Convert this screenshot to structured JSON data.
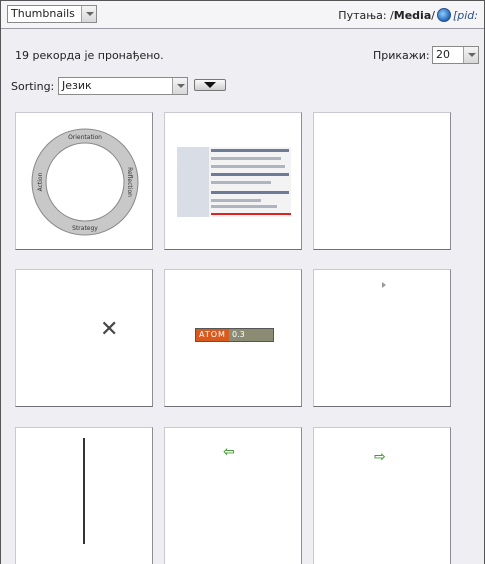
{
  "topbar": {
    "view_select": "Thumbnails",
    "path_label": "Путања: /",
    "path_current": "Media",
    "path_sep": "/",
    "pid_label": "[pid:"
  },
  "results": {
    "count_text": "19 рекорда је пронађено.",
    "show_label": "Прикажи:",
    "show_value": "20"
  },
  "sorting": {
    "label": "Sorting:",
    "value": "Језик"
  },
  "thumbnails": [
    {
      "name": "cycle-diagram",
      "labels": [
        "Orientation",
        "Reflection",
        "Strategy",
        "Action"
      ]
    },
    {
      "name": "screenshot"
    },
    {
      "name": "blank"
    },
    {
      "name": "delete-icon"
    },
    {
      "name": "atom-badge",
      "left": "ATOM",
      "right": "0.3"
    },
    {
      "name": "small-arrow"
    },
    {
      "name": "vertical-line"
    },
    {
      "name": "left-arrow"
    },
    {
      "name": "right-arrow"
    }
  ],
  "colors": {
    "accent": "#2a4f88",
    "atom_orange": "#d95a1f",
    "atom_olive": "#8c8c74",
    "arrow_green": "#4a9a3a"
  }
}
